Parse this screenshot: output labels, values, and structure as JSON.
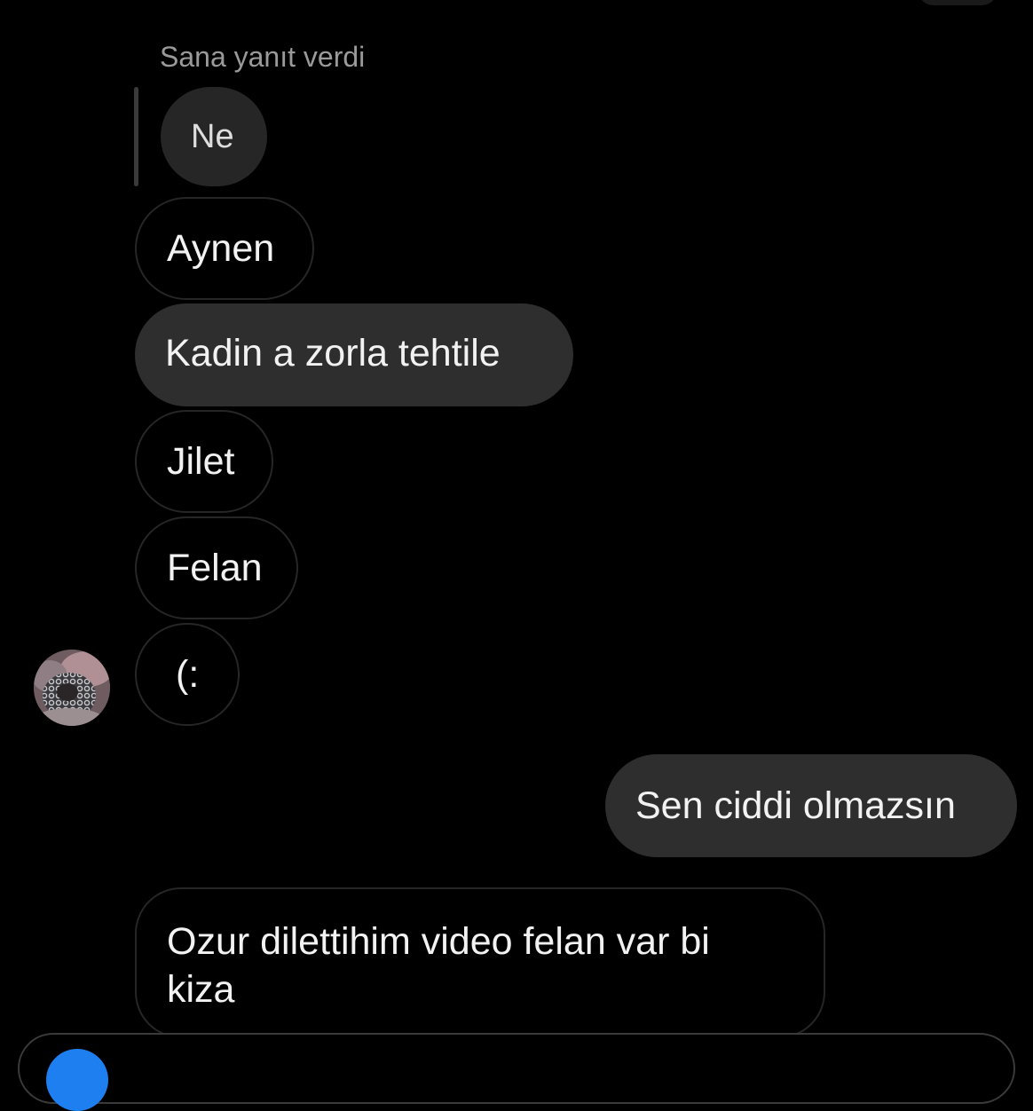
{
  "conversation": {
    "reply_label": "Sana yanıt verdi",
    "quoted_message": "Ne",
    "messages": [
      {
        "text": "Aynen",
        "sender": "other"
      },
      {
        "text": "Kadin a zorla tehtile",
        "sender": "other"
      },
      {
        "text": "Jilet",
        "sender": "other"
      },
      {
        "text": "Felan",
        "sender": "other"
      },
      {
        "text": "(:",
        "sender": "other"
      },
      {
        "text": "Sen ciddi olmazsın",
        "sender": "me"
      },
      {
        "text": "Ozur dilettihim video felan var bi kiza",
        "sender": "other"
      }
    ]
  },
  "icons": {
    "avatar": "contact-avatar",
    "composer_camera": "camera-icon"
  },
  "colors": {
    "background": "#000000",
    "bubble_filled": "#2e2e2e",
    "bubble_outline": "#262626",
    "reply_label": "#9a9a9a",
    "accent_blue": "#1e7ff0"
  }
}
